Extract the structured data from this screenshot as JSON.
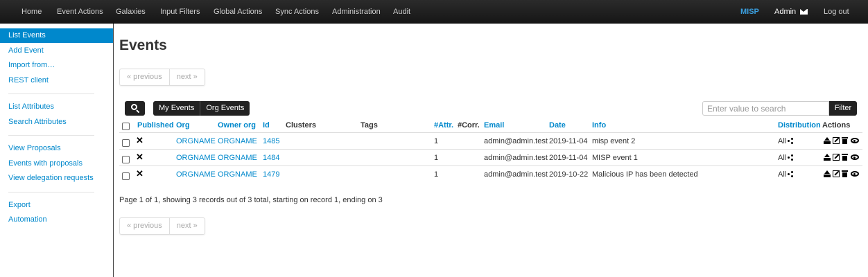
{
  "topnav": {
    "items": [
      "Home",
      "Event Actions",
      "Galaxies",
      "Input Filters",
      "Global Actions",
      "Sync Actions",
      "Administration",
      "Audit"
    ],
    "brand": "MISP",
    "user": "Admin",
    "logout": "Log out"
  },
  "sidebar": {
    "items": [
      "List Events",
      "Add Event",
      "Import from…",
      "REST client",
      "List Attributes",
      "Search Attributes",
      "View Proposals",
      "Events with proposals",
      "View delegation requests",
      "Export",
      "Automation"
    ],
    "active": "List Events"
  },
  "main": {
    "title": "Events",
    "pager": {
      "previous": "« previous",
      "next": "next »"
    },
    "toolbar": {
      "my_events": "My Events",
      "org_events": "Org Events",
      "search_placeholder": "Enter value to search",
      "filter": "Filter"
    },
    "columns": [
      "Published",
      "Org",
      "Owner org",
      "Id",
      "Clusters",
      "Tags",
      "#Attr.",
      "#Corr.",
      "Email",
      "Date",
      "Info",
      "Distribution",
      "Actions"
    ],
    "rows": [
      {
        "published": "✕",
        "org": "ORGNAME",
        "owner_org": "ORGNAME",
        "id": "1485",
        "clusters": "",
        "tags": "",
        "attr": "1",
        "corr": "",
        "email": "admin@admin.test",
        "date": "2019-11-04",
        "info": "misp event 2",
        "distribution": "All"
      },
      {
        "published": "✕",
        "org": "ORGNAME",
        "owner_org": "ORGNAME",
        "id": "1484",
        "clusters": "",
        "tags": "",
        "attr": "1",
        "corr": "",
        "email": "admin@admin.test",
        "date": "2019-11-04",
        "info": "MISP event 1",
        "distribution": "All"
      },
      {
        "published": "✕",
        "org": "ORGNAME",
        "owner_org": "ORGNAME",
        "id": "1479",
        "clusters": "",
        "tags": "",
        "attr": "1",
        "corr": "",
        "email": "admin@admin.test",
        "date": "2019-10-22",
        "info": "Malicious IP has been detected",
        "distribution": "All"
      }
    ],
    "summary": "Page 1 of 1, showing 3 records out of 3 total, starting on record 1, ending on 3"
  },
  "colors": {
    "link": "#0088cc",
    "navbar": "#1b1b1b",
    "active": "#0088cc"
  },
  "icons": [
    "search-icon",
    "envelope-icon",
    "share-icon",
    "publish-icon",
    "edit-icon",
    "trash-icon",
    "eye-icon"
  ]
}
